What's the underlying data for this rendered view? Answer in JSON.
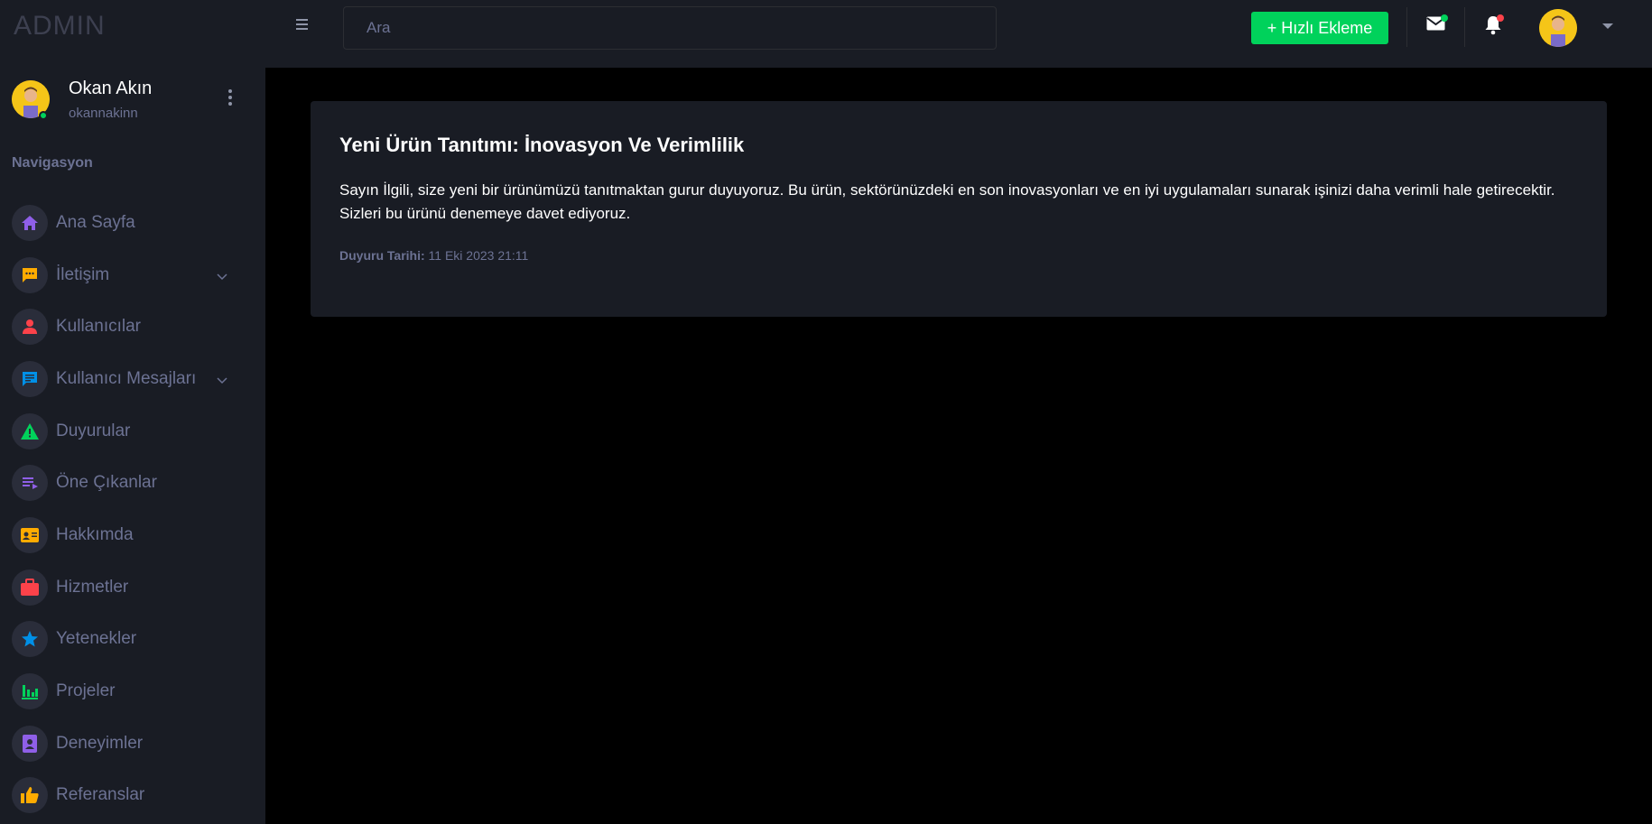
{
  "header": {
    "brand": "ADMIN",
    "search_placeholder": "Ara",
    "quick_add_label": "+ Hızlı Ekleme",
    "colors": {
      "quick_add": "#00d25b",
      "mail_dot": "#00d25b",
      "bell_dot": "#fc424a"
    }
  },
  "profile": {
    "name": "Okan Akın",
    "username": "okannakinn",
    "status_color": "#00d25b"
  },
  "sidebar": {
    "title": "Navigasyon",
    "items": [
      {
        "label": "Ana Sayfa",
        "icon": "home-icon",
        "color": "#8f5fe8",
        "has_submenu": false
      },
      {
        "label": "İletişim",
        "icon": "chat-icon",
        "color": "#ffab00",
        "has_submenu": true
      },
      {
        "label": "Kullanıcılar",
        "icon": "user-icon",
        "color": "#fc424a",
        "has_submenu": false
      },
      {
        "label": "Kullanıcı Mesajları",
        "icon": "message-icon",
        "color": "#0090e7",
        "has_submenu": true
      },
      {
        "label": "Duyurular",
        "icon": "alert-icon",
        "color": "#00d25b",
        "has_submenu": false
      },
      {
        "label": "Öne Çıkanlar",
        "icon": "playlist-icon",
        "color": "#8f5fe8",
        "has_submenu": false
      },
      {
        "label": "Hakkımda",
        "icon": "id-card-icon",
        "color": "#ffab00",
        "has_submenu": false
      },
      {
        "label": "Hizmetler",
        "icon": "briefcase-icon",
        "color": "#fc424a",
        "has_submenu": false
      },
      {
        "label": "Yetenekler",
        "icon": "star-icon",
        "color": "#0090e7",
        "has_submenu": false
      },
      {
        "label": "Projeler",
        "icon": "bar-chart-icon",
        "color": "#00d25b",
        "has_submenu": false
      },
      {
        "label": "Deneyimler",
        "icon": "contact-book-icon",
        "color": "#8f5fe8",
        "has_submenu": false
      },
      {
        "label": "Referanslar",
        "icon": "thumbs-up-icon",
        "color": "#ffab00",
        "has_submenu": false
      }
    ]
  },
  "announcement": {
    "title": "Yeni Ürün Tanıtımı: İnovasyon Ve Verimlilik",
    "body": "Sayın İlgili, size yeni bir ürünümüzü tanıtmaktan gurur duyuyoruz. Bu ürün, sektörünüzdeki en son inovasyonları ve en iyi uygulamaları sunarak işinizi daha verimli hale getirecektir. Sizleri bu ürünü denemeye davet ediyoruz.",
    "date_label": "Duyuru Tarihi:",
    "date_value": "11 Eki 2023 21:11"
  }
}
